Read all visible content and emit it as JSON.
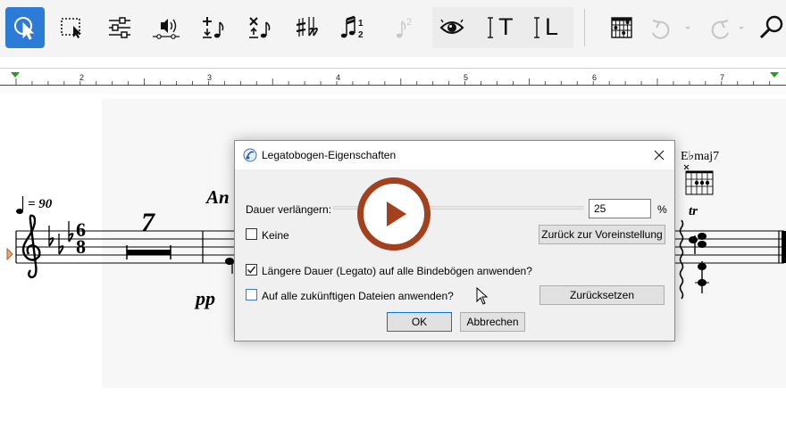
{
  "toolbar": {
    "buttons": [
      {
        "name": "select-tool",
        "icon": "cursor-icon"
      },
      {
        "name": "marquee-select",
        "icon": "marquee-select-icon"
      },
      {
        "name": "mixer",
        "icon": "sliders-icon"
      },
      {
        "name": "playback",
        "icon": "speaker-icon"
      },
      {
        "name": "simple-entry",
        "icon": "add-note-icon"
      },
      {
        "name": "simple-entry-delete",
        "icon": "delete-note-icon"
      },
      {
        "name": "accidentals",
        "icon": "sharp-flat-icon"
      },
      {
        "name": "tuplets",
        "icon": "tuplet-icon"
      },
      {
        "name": "tuplet-2",
        "icon": "tuplet-two-icon"
      },
      {
        "name": "view",
        "icon": "eye-icon"
      },
      {
        "name": "text-tool",
        "icon": "text-cursor-icon"
      },
      {
        "name": "lyrics-tool",
        "icon": "lyrics-icon"
      },
      {
        "name": "chord-tool",
        "icon": "chord-grid-icon"
      },
      {
        "name": "undo",
        "icon": "undo-icon"
      },
      {
        "name": "redo",
        "icon": "redo-icon"
      },
      {
        "name": "search",
        "icon": "search-icon"
      }
    ],
    "tuplet_label": "1\n2",
    "text_tool_label": "T",
    "lyrics_tool_label": "L"
  },
  "ruler": {
    "marks": [
      "2",
      "3",
      "4",
      "5",
      "6",
      "7"
    ]
  },
  "score": {
    "tempo": "= 90",
    "time_signature_top": "6",
    "time_signature_bottom": "8",
    "multirest_count": "7",
    "expression_partial": "An",
    "dynamic": "pp",
    "chord_symbol": "E♭maj7",
    "trill": "tr"
  },
  "dialog": {
    "title": "Legatobogen-Eigenschaften",
    "extend_duration_label": "Dauer verlängern:",
    "extend_duration_value": "25",
    "percent_unit": "%",
    "none_label": "Keine",
    "reset_default_label": "Zurück zur Voreinstellung",
    "apply_all_label": "Längere Dauer (Legato) auf alle Bindebögen anwenden?",
    "apply_all_checked": true,
    "apply_future_label": "Auf alle zukünftigen Dateien anwenden?",
    "apply_future_checked": false,
    "reset_label": "Zurücksetzen",
    "ok_label": "OK",
    "cancel_label": "Abbrechen",
    "slider_value_percent": 25
  },
  "colors": {
    "accent": "#2c7bd6",
    "play_ring": "#a3401d",
    "play_icon": "#a3401d",
    "slider_thumb": "#0078d7",
    "ruler_marker": "#1fa31f"
  }
}
